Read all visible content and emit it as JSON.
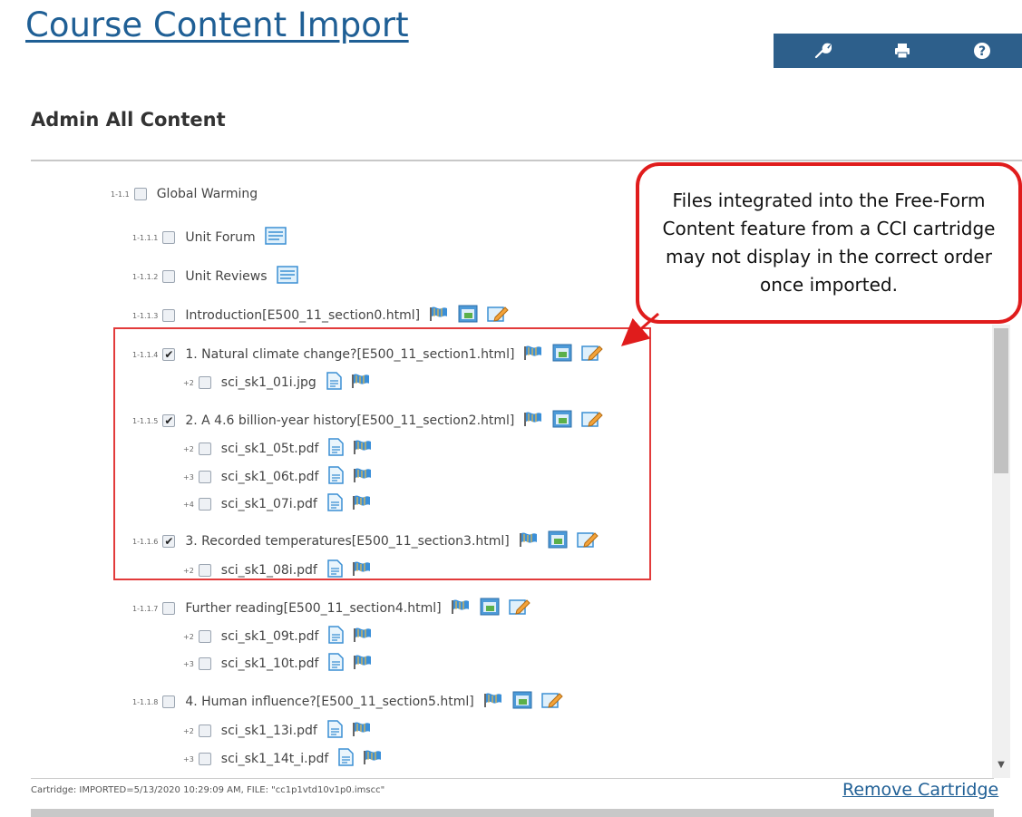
{
  "page": {
    "title": "Course Content Import",
    "section_title": "Admin All Content"
  },
  "toolbar": {
    "icons": [
      "wrench-icon",
      "print-icon",
      "help-icon"
    ],
    "color": "#2d5f8b"
  },
  "tree": [
    {
      "num": "1-1.1",
      "label": "Global Warming",
      "checked": false,
      "icons": []
    },
    {
      "num": "1-1.1.1",
      "label": "Unit Forum",
      "checked": false,
      "icons": [
        "forum"
      ]
    },
    {
      "num": "1-1.1.2",
      "label": "Unit Reviews",
      "checked": false,
      "icons": [
        "forum"
      ]
    },
    {
      "num": "1-1.1.3",
      "label": "Introduction[E500_11_section0.html]",
      "checked": false,
      "icons": [
        "flag",
        "page",
        "edit"
      ]
    },
    {
      "num": "1-1.1.4",
      "label": "1. Natural climate change?[E500_11_section1.html]",
      "checked": true,
      "icons": [
        "flag",
        "page",
        "edit"
      ]
    },
    {
      "num": "+2",
      "label": "sci_sk1_01i.jpg",
      "checked": false,
      "icons": [
        "doc",
        "flag"
      ]
    },
    {
      "num": "1-1.1.5",
      "label": "2. A 4.6 billion-year history[E500_11_section2.html]",
      "checked": true,
      "icons": [
        "flag",
        "page",
        "edit"
      ]
    },
    {
      "num": "+2",
      "label": "sci_sk1_05t.pdf",
      "checked": false,
      "icons": [
        "doc",
        "flag"
      ]
    },
    {
      "num": "+3",
      "label": "sci_sk1_06t.pdf",
      "checked": false,
      "icons": [
        "doc",
        "flag"
      ]
    },
    {
      "num": "+4",
      "label": "sci_sk1_07i.pdf",
      "checked": false,
      "icons": [
        "doc",
        "flag"
      ]
    },
    {
      "num": "1-1.1.6",
      "label": "3. Recorded temperatures[E500_11_section3.html]",
      "checked": true,
      "icons": [
        "flag",
        "page",
        "edit"
      ]
    },
    {
      "num": "+2",
      "label": "sci_sk1_08i.pdf",
      "checked": false,
      "icons": [
        "doc",
        "flag"
      ]
    },
    {
      "num": "1-1.1.7",
      "label": "Further reading[E500_11_section4.html]",
      "checked": false,
      "icons": [
        "flag",
        "page",
        "edit"
      ]
    },
    {
      "num": "+2",
      "label": "sci_sk1_09t.pdf",
      "checked": false,
      "icons": [
        "doc",
        "flag"
      ]
    },
    {
      "num": "+3",
      "label": "sci_sk1_10t.pdf",
      "checked": false,
      "icons": [
        "doc",
        "flag"
      ]
    },
    {
      "num": "1-1.1.8",
      "label": "4. Human influence?[E500_11_section5.html]",
      "checked": false,
      "icons": [
        "flag",
        "page",
        "edit"
      ]
    },
    {
      "num": "+2",
      "label": "sci_sk1_13i.pdf",
      "checked": false,
      "icons": [
        "doc",
        "flag"
      ]
    },
    {
      "num": "+3",
      "label": "sci_sk1_14t_i.pdf",
      "checked": false,
      "icons": [
        "doc",
        "flag"
      ]
    }
  ],
  "callout": {
    "text": "Files integrated into the Free-Form Content feature from a CCI cartridge may not display in the correct order once imported.",
    "border_color": "#e01c1c"
  },
  "footer": {
    "cartridge_info": "Cartridge: IMPORTED=5/13/2020 10:29:09 AM, FILE: \"cc1p1vtd10v1p0.imscc\"",
    "remove_link": "Remove Cartridge"
  }
}
